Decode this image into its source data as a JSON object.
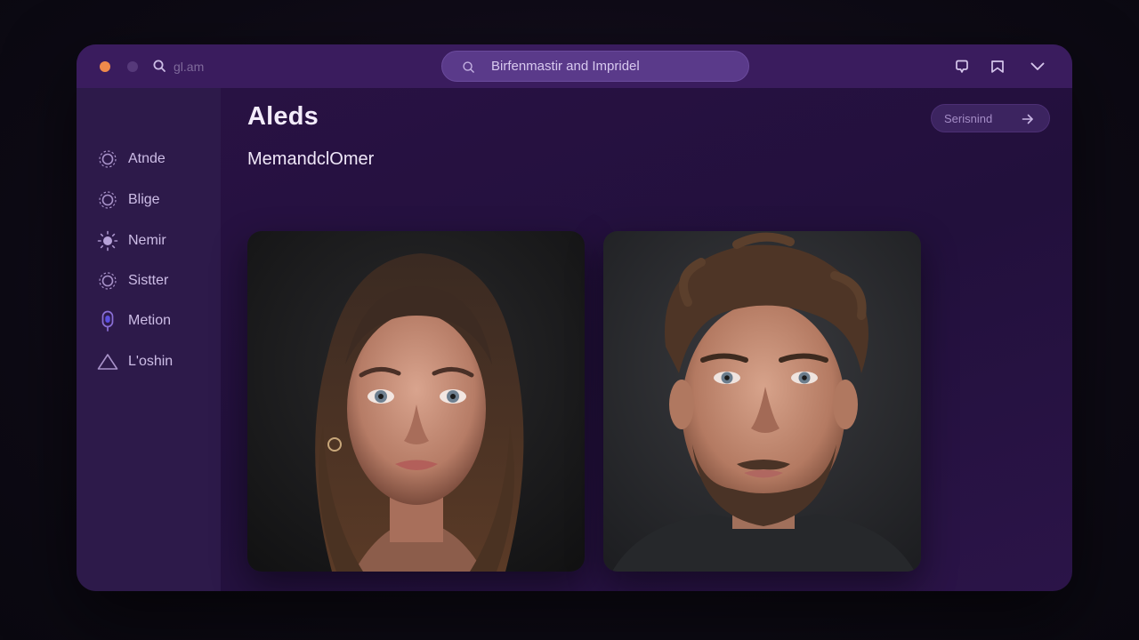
{
  "titlebar": {
    "search_hint": "gl.am",
    "search": {
      "value": "Birfenmastir and Impridel"
    }
  },
  "sidebar": {
    "items": [
      {
        "label": "Atnde",
        "icon": "sun-gear-icon"
      },
      {
        "label": "Blige",
        "icon": "sun-gear-icon"
      },
      {
        "label": "Nemir",
        "icon": "sun-icon"
      },
      {
        "label": "Sistter",
        "icon": "sun-gear-icon"
      },
      {
        "label": "Metion",
        "icon": "pin-icon"
      },
      {
        "label": "L'oshin",
        "icon": "triangle-icon"
      }
    ]
  },
  "main": {
    "title": "Aleds",
    "subtitle": "MemandclOmer",
    "action_label": "Serisnind"
  },
  "photos": [
    {
      "subject": "woman-portrait-icon"
    },
    {
      "subject": "man-portrait-icon"
    }
  ],
  "colors": {
    "accent_orange": "#f08a4b",
    "window_bg": "#22103c",
    "titlebar_bg": "#3a1c5e",
    "search_bg": "#5a3a8a"
  }
}
